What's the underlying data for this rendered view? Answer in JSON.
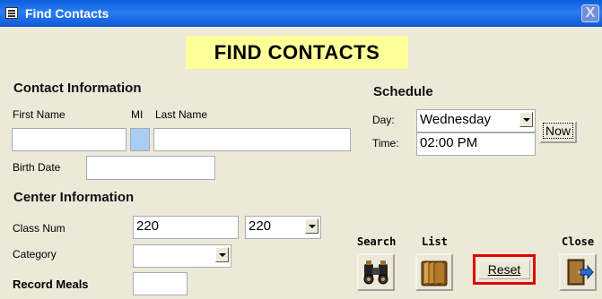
{
  "window": {
    "title": "Find Contacts",
    "close_glyph": "X",
    "icon": "form-icon"
  },
  "banner": {
    "text": "FIND CONTACTS"
  },
  "contact_info": {
    "heading": "Contact Information",
    "first_name_label": "First Name",
    "mi_label": "MI",
    "last_name_label": "Last Name",
    "first_name_value": "",
    "mi_value": "",
    "last_name_value": "",
    "birth_date_label": "Birth Date",
    "birth_date_value": ""
  },
  "schedule": {
    "heading": "Schedule",
    "day_label": "Day:",
    "day_value": "Wednesday",
    "time_label": "Time:",
    "time_value": "02:00 PM",
    "now_label": "Now"
  },
  "center_info": {
    "heading": "Center Information",
    "class_num_label": "Class Num",
    "class_num_value": "220",
    "class_num_combo_value": "220",
    "category_label": "Category",
    "category_value": "",
    "record_meals_label": "Record Meals",
    "record_meals_value": ""
  },
  "actions": {
    "search_label": "Search",
    "list_label": "List",
    "reset_label": "Reset",
    "close_label": "Close"
  },
  "colors": {
    "title_bar": "#0a5fdc",
    "banner_bg": "#ffff99",
    "window_bg": "#ece9d8",
    "reset_border": "#e00000",
    "mi_field_bg": "#a9cdf5"
  }
}
